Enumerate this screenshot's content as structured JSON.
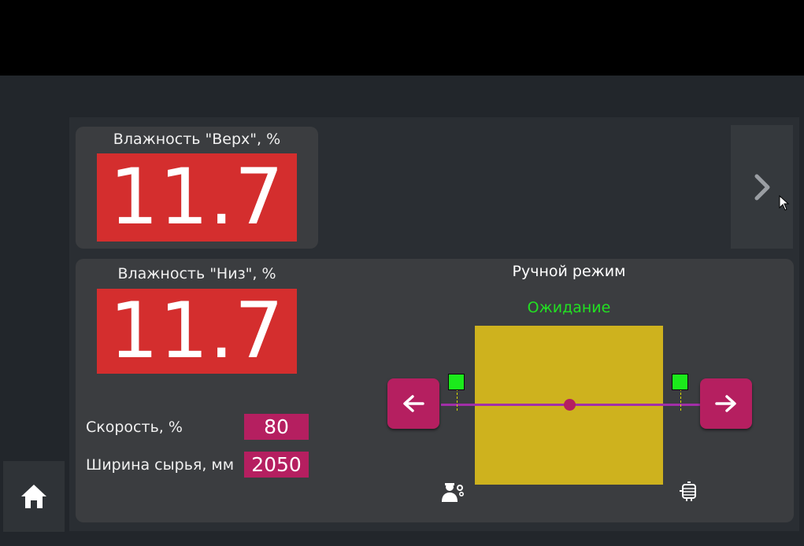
{
  "top_panel": {
    "label": "Влажность \"Верх\", %",
    "value": "11.7"
  },
  "bottom_panel": {
    "label": "Влажность \"Низ\", %",
    "value": "11.7",
    "speed_label": "Скорость, %",
    "speed_value": "80",
    "width_label": "Ширина сырья, мм",
    "width_value": "2050"
  },
  "mode": {
    "title": "Ручной режим",
    "status": "Ожидание"
  },
  "icons": {
    "home": "home-icon",
    "next": "chevron-right-icon",
    "left": "arrow-left-icon",
    "right": "arrow-right-icon",
    "operator": "operator-gear-icon",
    "motor": "motor-icon"
  },
  "colors": {
    "value_bg": "#d42e2e",
    "field_bg": "#b51f60",
    "material": "#ceb21e",
    "sensor": "#1bea1b",
    "status": "#22e022",
    "track": "#a12fa8"
  }
}
